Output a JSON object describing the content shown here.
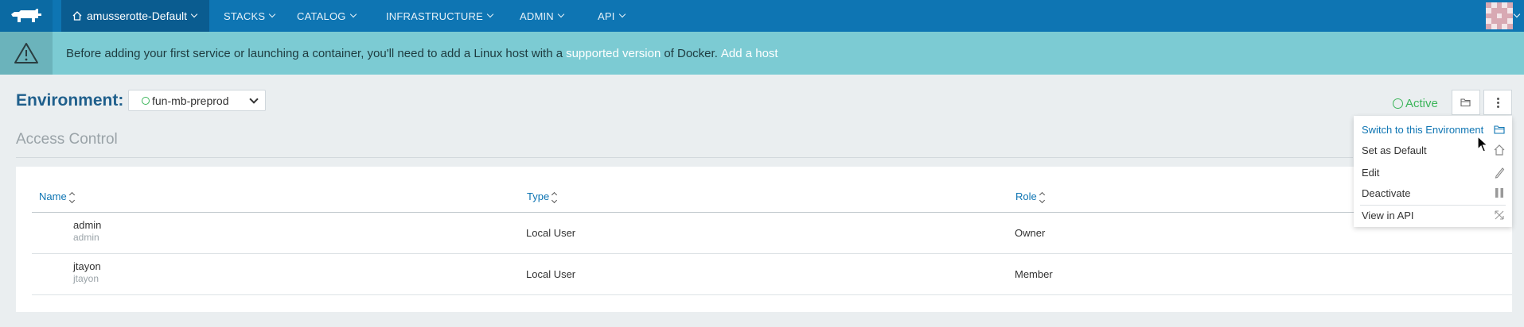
{
  "topbar": {
    "environment": "amusserotte-Default",
    "nav": [
      "STACKS",
      "CATALOG",
      "INFRASTRUCTURE",
      "ADMIN",
      "API"
    ],
    "logo_icon": "rancher-cow-icon",
    "avatar_icon": "identicon-avatar"
  },
  "banner": {
    "text_before": "Before adding your first service or launching a container, you'll need to add a Linux host with a",
    "link_supported": "supported version",
    "text_after": "of Docker.",
    "link_add_host": "Add a host",
    "icon": "warning-triangle-icon"
  },
  "environment": {
    "label": "Environment:",
    "selected": "fun-mb-preprod",
    "status": "Active"
  },
  "section": {
    "title": "Access Control"
  },
  "table": {
    "columns": [
      "Name",
      "Type",
      "Role"
    ],
    "rows": [
      {
        "name": "admin",
        "username": "admin",
        "type": "Local User",
        "role": "Owner"
      },
      {
        "name": "jtayon",
        "username": "jtayon",
        "type": "Local User",
        "role": "Member"
      }
    ]
  },
  "menu": {
    "items": [
      {
        "label": "Switch to this Environment",
        "icon": "folder-open-icon"
      },
      {
        "label": "Set as Default",
        "icon": "home-icon"
      },
      {
        "label": "Edit",
        "icon": "pencil-icon"
      },
      {
        "label": "Deactivate",
        "icon": "pause-icon"
      },
      {
        "label": "View in API",
        "icon": "external-link-icon"
      }
    ]
  },
  "colors": {
    "nav": "#0e75b3",
    "banner": "#7ccbd3",
    "active": "#3cb55a"
  }
}
